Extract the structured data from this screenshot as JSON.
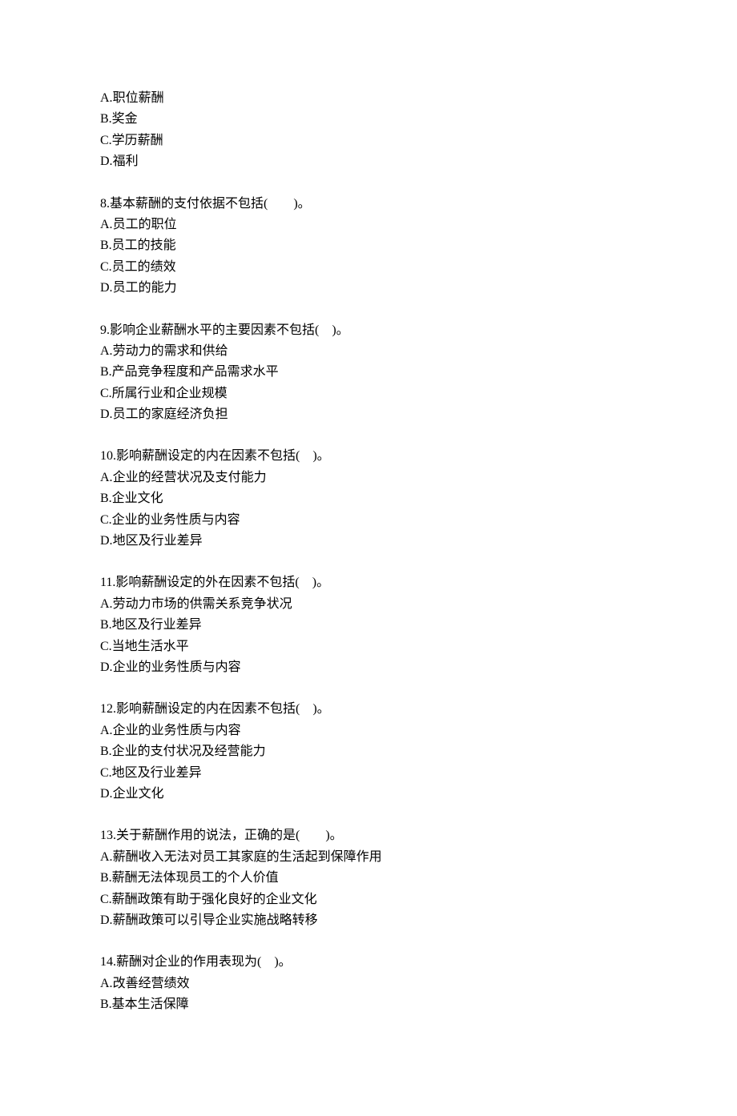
{
  "partial_first": {
    "options": [
      {
        "label": "A.",
        "text": "职位薪酬"
      },
      {
        "label": "B.",
        "text": "奖金"
      },
      {
        "label": "C.",
        "text": "学历薪酬"
      },
      {
        "label": "D.",
        "text": "福利"
      }
    ]
  },
  "questions": [
    {
      "number": "8.",
      "stem": "基本薪酬的支付依据不包括(　　)。",
      "options": [
        {
          "label": "A.",
          "text": "员工的职位"
        },
        {
          "label": "B.",
          "text": "员工的技能"
        },
        {
          "label": "C.",
          "text": "员工的绩效"
        },
        {
          "label": "D.",
          "text": "员工的能力"
        }
      ]
    },
    {
      "number": "9.",
      "stem": "影响企业薪酬水平的主要因素不包括(　)。",
      "options": [
        {
          "label": "A.",
          "text": "劳动力的需求和供给"
        },
        {
          "label": "B.",
          "text": "产品竞争程度和产品需求水平"
        },
        {
          "label": "C.",
          "text": "所属行业和企业规模"
        },
        {
          "label": "D.",
          "text": "员工的家庭经济负担"
        }
      ]
    },
    {
      "number": "10.",
      "stem": "影响薪酬设定的内在因素不包括(　)。",
      "options": [
        {
          "label": "A.",
          "text": "企业的经营状况及支付能力"
        },
        {
          "label": "B.",
          "text": "企业文化"
        },
        {
          "label": "C.",
          "text": "企业的业务性质与内容"
        },
        {
          "label": "D.",
          "text": "地区及行业差异"
        }
      ]
    },
    {
      "number": "11.",
      "stem": "影响薪酬设定的外在因素不包括(　)。",
      "options": [
        {
          "label": "A.",
          "text": "劳动力市场的供需关系竞争状况"
        },
        {
          "label": "B.",
          "text": "地区及行业差异"
        },
        {
          "label": "C.",
          "text": "当地生活水平"
        },
        {
          "label": "D.",
          "text": "企业的业务性质与内容"
        }
      ]
    },
    {
      "number": "12.",
      "stem": "影响薪酬设定的内在因素不包括(　)。",
      "options": [
        {
          "label": "A.",
          "text": "企业的业务性质与内容"
        },
        {
          "label": "B.",
          "text": "企业的支付状况及经营能力"
        },
        {
          "label": "C.",
          "text": "地区及行业差异"
        },
        {
          "label": "D.",
          "text": "企业文化"
        }
      ]
    },
    {
      "number": "13.",
      "stem": "关于薪酬作用的说法，正确的是(　　)。",
      "options": [
        {
          "label": "A.",
          "text": "薪酬收入无法对员工其家庭的生活起到保障作用"
        },
        {
          "label": "B.",
          "text": "薪酬无法体现员工的个人价值"
        },
        {
          "label": "C.",
          "text": "薪酬政策有助于强化良好的企业文化"
        },
        {
          "label": "D.",
          "text": "薪酬政策可以引导企业实施战略转移"
        }
      ]
    },
    {
      "number": "14.",
      "stem": "薪酬对企业的作用表现为(　)。",
      "options": [
        {
          "label": "A.",
          "text": "改善经营绩效"
        },
        {
          "label": "B.",
          "text": "基本生活保障"
        }
      ]
    }
  ]
}
